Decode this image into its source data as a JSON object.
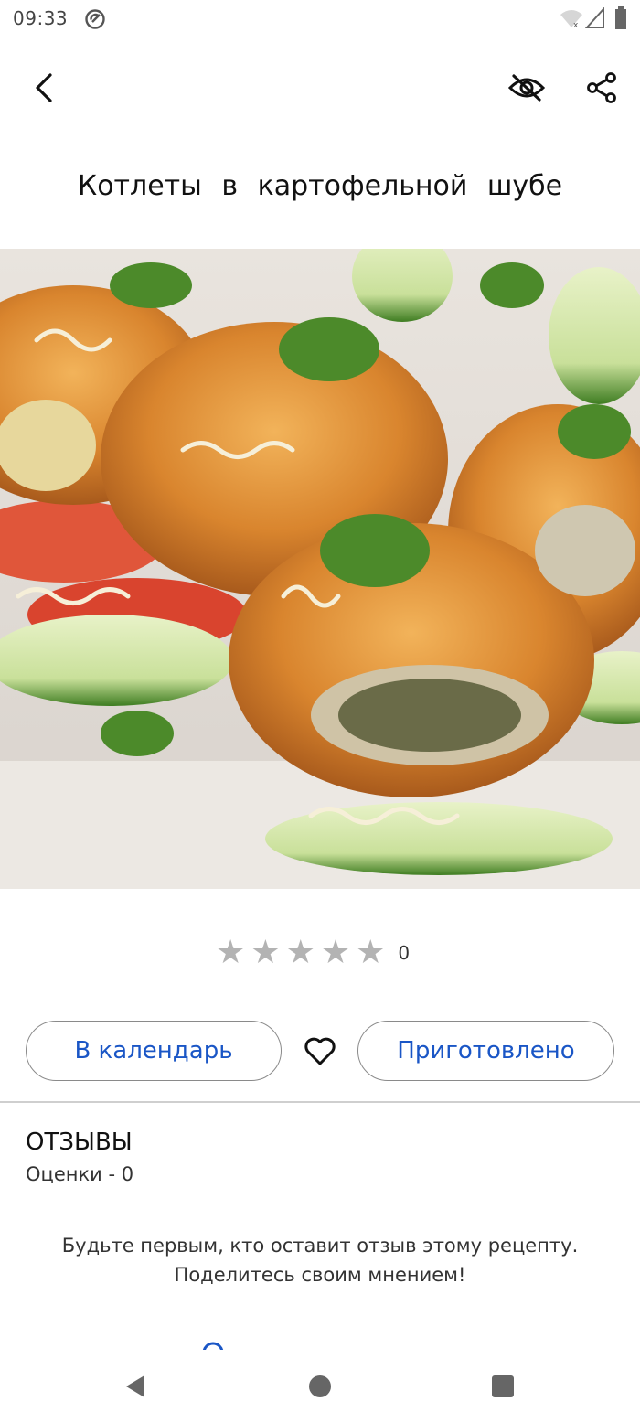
{
  "status_bar": {
    "time": "09:33",
    "icons": [
      "do-not-disturb-icon",
      "wifi-off-icon",
      "signal-icon",
      "battery-icon"
    ]
  },
  "app_bar": {
    "back_icon": "arrow-back-icon",
    "hide_icon": "eye-off-icon",
    "share_icon": "share-icon"
  },
  "recipe": {
    "title": "Котлеты  в  картофельной  шубе",
    "image_alt": "cutlets in potato crust with cucumbers and parsley"
  },
  "rating": {
    "stars_total": 5,
    "stars_filled": 0,
    "count": "0"
  },
  "actions": {
    "calendar_label": "В календарь",
    "favorite_icon": "heart-outline-icon",
    "cooked_label": "Приготовлено"
  },
  "reviews": {
    "title": "ОТЗЫВЫ",
    "ratings_label": "Оценки - 0",
    "empty_message": "Будьте первым, кто оставит отзыв этому рецепту. Поделитесь своим мнением!"
  },
  "colors": {
    "accent": "#1a56c6",
    "star_empty": "#b3b3b3",
    "divider": "#cfcfcf"
  }
}
